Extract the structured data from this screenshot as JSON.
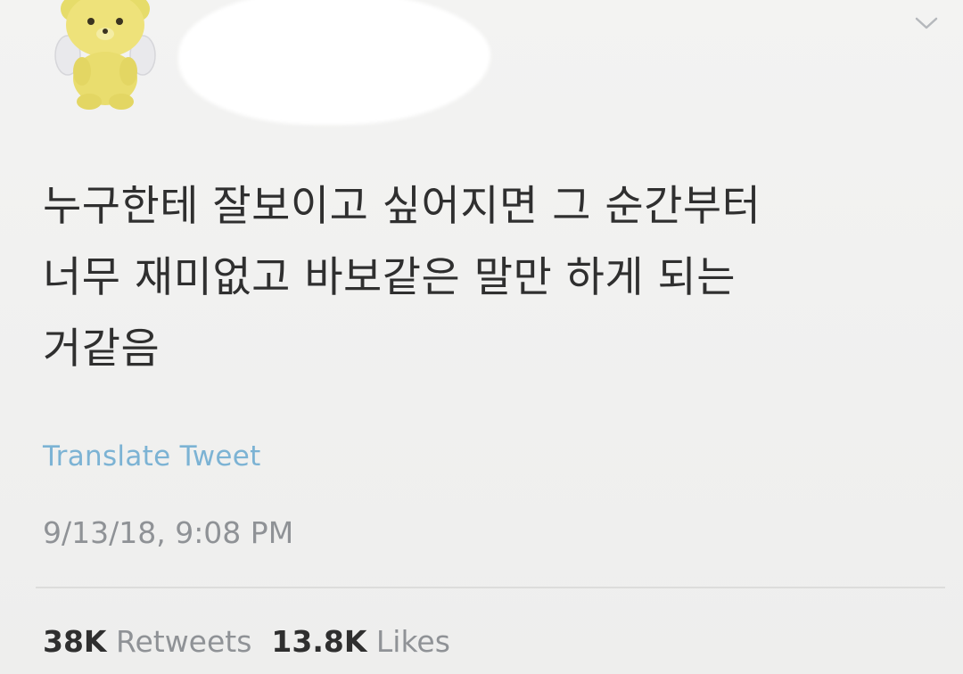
{
  "tweet": {
    "text_lines": [
      "누구한테 잘보이고 싶어지면 그 순간부터",
      "너무 재미없고 바보같은 말만 하게 되는",
      "거같음"
    ],
    "translate_label": "Translate Tweet",
    "timestamp": "9/13/18, 9:08 PM",
    "retweets_count": "38K",
    "retweets_label": "Retweets",
    "likes_count": "13.8K",
    "likes_label": "Likes"
  },
  "icons": {
    "avatar": "yellow-bear-avatar",
    "menu": "chevron-down-icon"
  },
  "colors": {
    "background": "#f1f1f0",
    "text": "#2f2f2f",
    "link": "#7cb3d4",
    "muted": "#8f9296"
  }
}
